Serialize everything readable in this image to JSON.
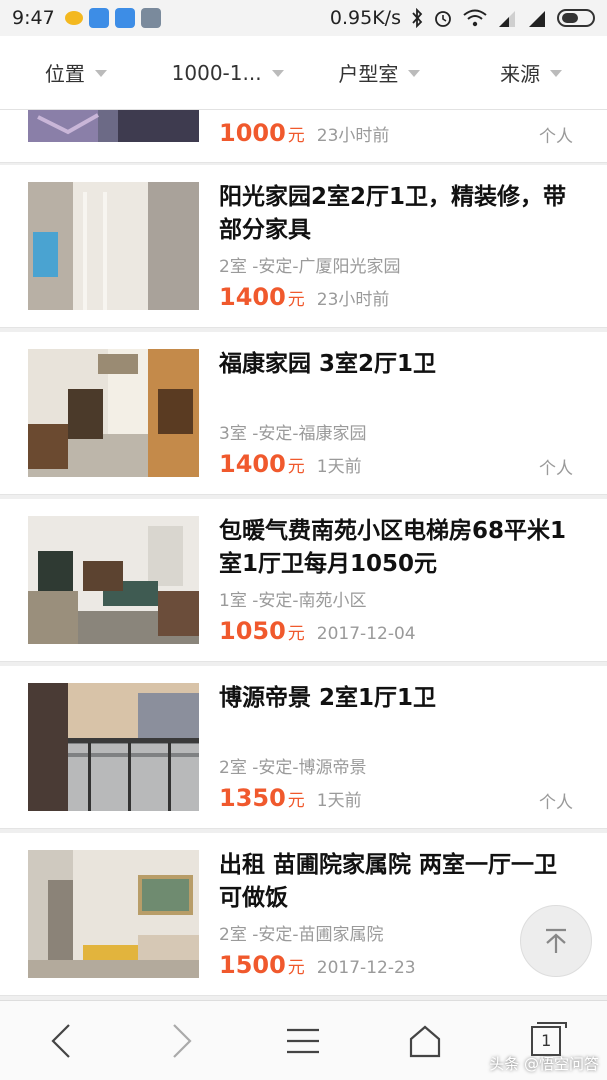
{
  "status_bar": {
    "time": "9:47",
    "network_speed": "0.95K/s"
  },
  "filters": [
    {
      "label": "位置"
    },
    {
      "label": "1000-1..."
    },
    {
      "label": "户型室"
    },
    {
      "label": "来源"
    }
  ],
  "listings": [
    {
      "title": "",
      "meta": "",
      "price": "1000",
      "unit": "元",
      "time": "23小时前",
      "source": "个人"
    },
    {
      "title": "阳光家园2室2厅1卫，精装修，带部分家具",
      "meta": "2室 -安定-广厦阳光家园",
      "price": "1400",
      "unit": "元",
      "time": "23小时前",
      "source": ""
    },
    {
      "title": "福康家园 3室2厅1卫",
      "meta": "3室 -安定-福康家园",
      "price": "1400",
      "unit": "元",
      "time": "1天前",
      "source": "个人"
    },
    {
      "title": "包暖气费南苑小区电梯房68平米1室1厅卫每月1050元",
      "meta": "1室 -安定-南苑小区",
      "price": "1050",
      "unit": "元",
      "time": "2017-12-04",
      "source": ""
    },
    {
      "title": "博源帝景 2室1厅1卫",
      "meta": "2室 -安定-博源帝景",
      "price": "1350",
      "unit": "元",
      "time": "1天前",
      "source": "个人"
    },
    {
      "title": "出租 苗圃院家属院 两室一厅一卫 可做饭",
      "meta": "2室 -安定-苗圃家属院",
      "price": "1500",
      "unit": "元",
      "time": "2017-12-23",
      "source": ""
    }
  ],
  "bottom_nav": {
    "tab_count": "1"
  },
  "watermark": "头条 @悟空问答",
  "colors": {
    "price": "#f0592d",
    "meta": "#9a9a9a"
  }
}
